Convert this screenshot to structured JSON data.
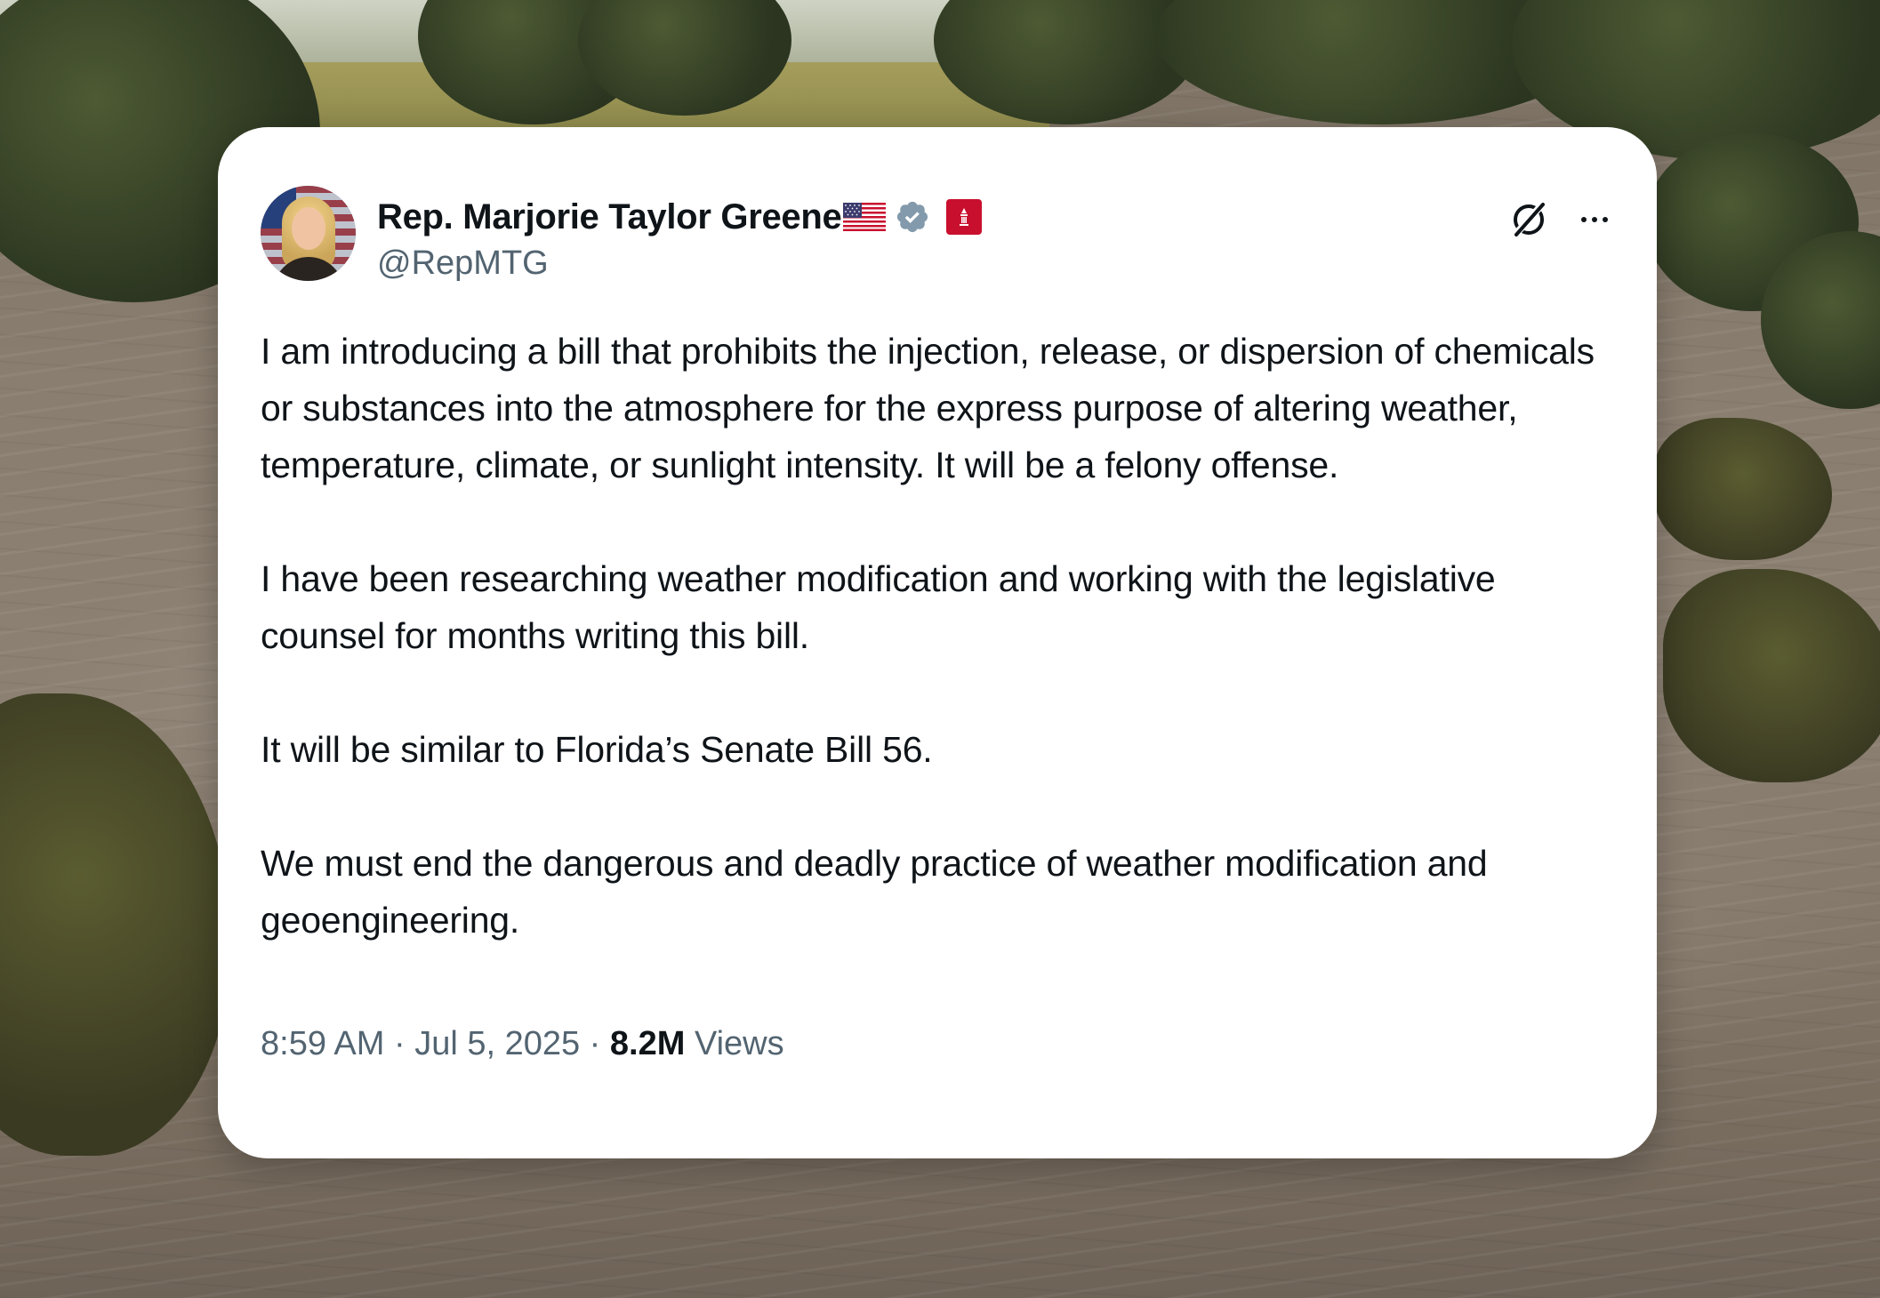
{
  "tweet": {
    "display_name": "Rep. Marjorie Taylor Greene",
    "handle": "@RepMTG",
    "paragraphs": [
      "I am introducing a bill that prohibits the injection, release, or dispersion of chemicals or substances into the atmosphere for the express purpose of altering weather, temperature, climate, or sunlight intensity. It will be a felony offense.",
      "I have been researching weather modification and working with the legislative counsel for months writing this bill.",
      "It will be similar to Florida’s Senate Bill 56.",
      "We must end the dangerous and deadly practice of weather modification and geoengineering."
    ],
    "time": "8:59 AM",
    "separator": " · ",
    "date": "Jul 5, 2025",
    "views_count": "8.2M",
    "views_label": " Views"
  },
  "icons": {
    "flag": "us-flag-icon",
    "verified": "verified-badge-icon",
    "affiliate": "house-seal-icon",
    "grok": "grok-icon",
    "more": "more-icon"
  },
  "colors": {
    "text_primary": "#0f1419",
    "text_secondary": "#536471",
    "verified_badge": "#829aab",
    "affiliate_badge": "#c8102e",
    "card_background": "#ffffff"
  }
}
